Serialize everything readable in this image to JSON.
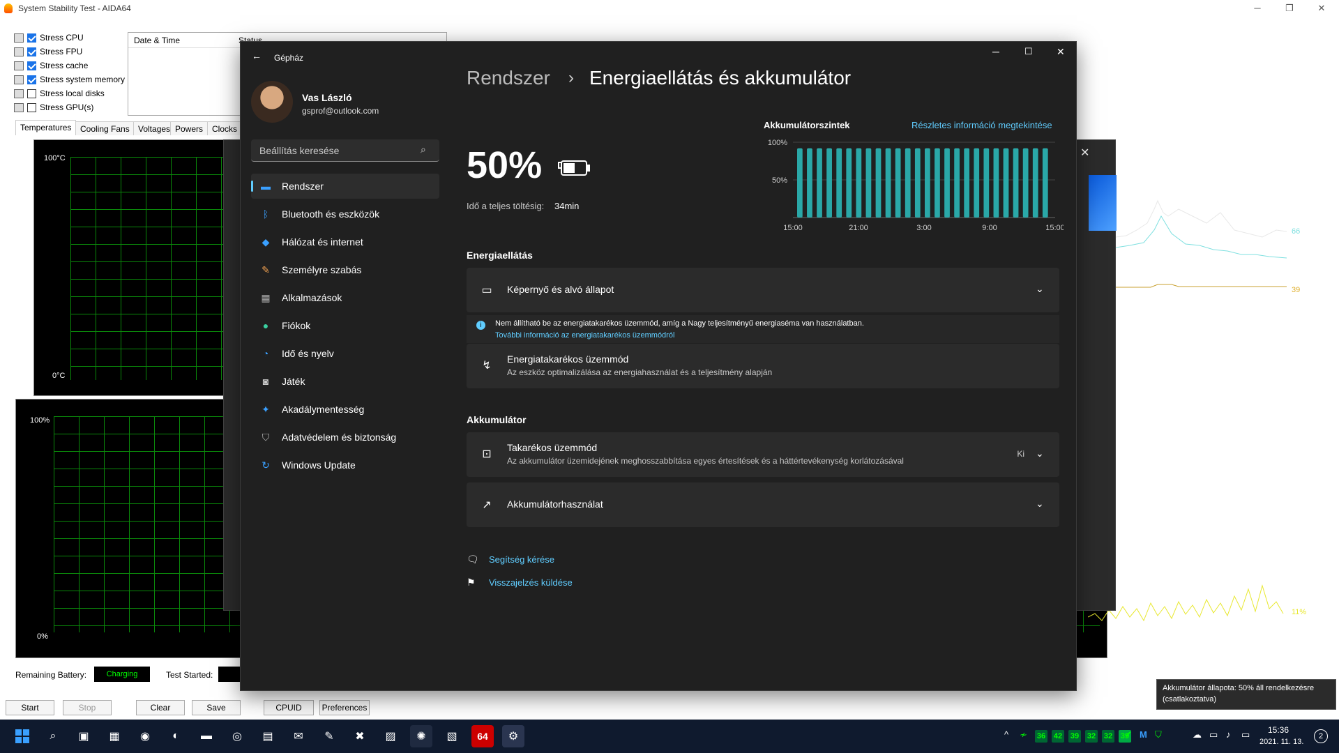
{
  "aida": {
    "title": "System Stability Test - AIDA64",
    "stress_items": [
      {
        "label": "Stress CPU",
        "checked": true
      },
      {
        "label": "Stress FPU",
        "checked": true
      },
      {
        "label": "Stress cache",
        "checked": true
      },
      {
        "label": "Stress system memory",
        "checked": true
      },
      {
        "label": "Stress local disks",
        "checked": false
      },
      {
        "label": "Stress GPU(s)",
        "checked": false
      }
    ],
    "log_header_date": "Date & Time",
    "log_header_status": "Status",
    "tabs": [
      "Temperatures",
      "Cooling Fans",
      "Voltages",
      "Powers",
      "Clocks"
    ],
    "temp_axis_top": "100°C",
    "temp_axis_bottom": "0°C",
    "usage_axis_top": "100%",
    "usage_axis_bottom": "0%",
    "temp_values": [
      "66",
      "54",
      "39"
    ],
    "usage_value": "11%",
    "remaining_battery_label": "Remaining Battery:",
    "remaining_battery_value": "Charging",
    "test_started_label": "Test Started:",
    "buttons": [
      "Start",
      "Stop",
      "Clear",
      "Save",
      "CPUID",
      "Preferences"
    ]
  },
  "settings": {
    "window_title": "Gépház",
    "user_name": "Vas László",
    "user_email": "gsprof@outlook.com",
    "search_placeholder": "Beállítás keresése",
    "nav": [
      {
        "label": "Rendszer",
        "icon": "monitor-icon"
      },
      {
        "label": "Bluetooth és eszközök",
        "icon": "bluetooth-icon"
      },
      {
        "label": "Hálózat és internet",
        "icon": "wifi-icon"
      },
      {
        "label": "Személyre szabás",
        "icon": "brush-icon"
      },
      {
        "label": "Alkalmazások",
        "icon": "apps-icon"
      },
      {
        "label": "Fiókok",
        "icon": "person-icon"
      },
      {
        "label": "Idő és nyelv",
        "icon": "globe-clock-icon"
      },
      {
        "label": "Játék",
        "icon": "gamepad-icon"
      },
      {
        "label": "Akadálymentesség",
        "icon": "accessibility-icon"
      },
      {
        "label": "Adatvédelem és biztonság",
        "icon": "shield-icon"
      },
      {
        "label": "Windows Update",
        "icon": "update-icon"
      }
    ],
    "breadcrumb_parent": "Rendszer",
    "breadcrumb_sep": "›",
    "page_title": "Energiaellátás és akkumulátor",
    "battery_percent": "50%",
    "time_to_full_label": "Idő a teljes töltésig:",
    "time_to_full_value": "34min",
    "levels_title": "Akkumulátorszintek",
    "details_link": "Részletes információ megtekintése",
    "section_power": "Energiaellátás",
    "screen_sleep": "Képernyő és alvó állapot",
    "info_text": "Nem állítható be az energiatakarékos üzemmód, amíg a Nagy teljesítményű energiaséma van használatban.",
    "info_link": "További információ az energiatakarékos üzemmódról",
    "power_mode_title": "Energiatakarékos üzemmód",
    "power_mode_sub": "Az eszköz optimalizálása az energiahasználat és a teljesítmény alapján",
    "section_battery": "Akkumulátor",
    "saver_title": "Takarékos üzemmód",
    "saver_sub": "Az akkumulátor üzemidejének meghosszabbítása egyes értesítések és a háttértevékenység korlátozásával",
    "saver_state": "Ki",
    "usage_title": "Akkumulátorhasználat",
    "help_link": "Segítség kérése",
    "feedback_link": "Visszajelzés küldése"
  },
  "chart_data": {
    "type": "bar",
    "title": "Akkumulátorszintek",
    "y_ticks": [
      "100%",
      "50%"
    ],
    "x_ticks": [
      "15:00",
      "21:00",
      "3:00",
      "9:00",
      "15:00"
    ],
    "ylim": [
      0,
      100
    ],
    "values": [
      92,
      92,
      92,
      92,
      92,
      92,
      92,
      92,
      92,
      92,
      92,
      92,
      92,
      92,
      92,
      92,
      92,
      92,
      92,
      92,
      92,
      92,
      92,
      92,
      92,
      92
    ],
    "color": "#2aa8a8"
  },
  "tooltip": {
    "text": "Akkumulátor állapota: 50% áll rendelkezésre (csatlakoztatva)"
  },
  "taskbar": {
    "tray_numbers": [
      "36",
      "42",
      "39",
      "32",
      "32",
      "39"
    ],
    "time": "15:36",
    "date": "2021. 11. 13.",
    "notif_count": "2",
    "aida_badge": "64"
  }
}
